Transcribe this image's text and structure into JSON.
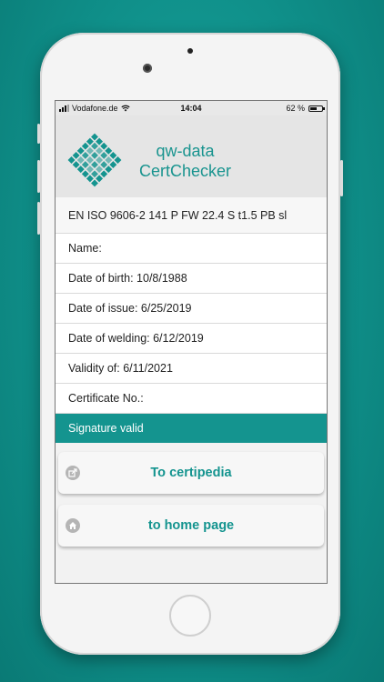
{
  "status_bar": {
    "carrier": "Vodafone.de",
    "time": "14:04",
    "battery": "62 %",
    "battery_level": 0.62
  },
  "header": {
    "app_line1": "qw-data",
    "app_line2": "CertChecker",
    "logo_icon": "diamond-grid-logo",
    "brand_color": "#14948f"
  },
  "certificate": {
    "designation": "EN ISO 9606-2 141 P FW 22.4 S t1.5 PB sl",
    "name": "Name:",
    "date_of_birth": "Date of birth: 10/8/1988",
    "date_of_issue": "Date of issue: 6/25/2019",
    "date_of_welding": "Date of welding: 6/12/2019",
    "validity": "Validity of: 6/11/2021",
    "certificate_no": "Certificate No.:",
    "signature_status": "Signature valid"
  },
  "actions": {
    "certipedia_label": "To certipedia",
    "certipedia_icon": "share-icon",
    "home_label": "to home page",
    "home_icon": "home-icon"
  }
}
